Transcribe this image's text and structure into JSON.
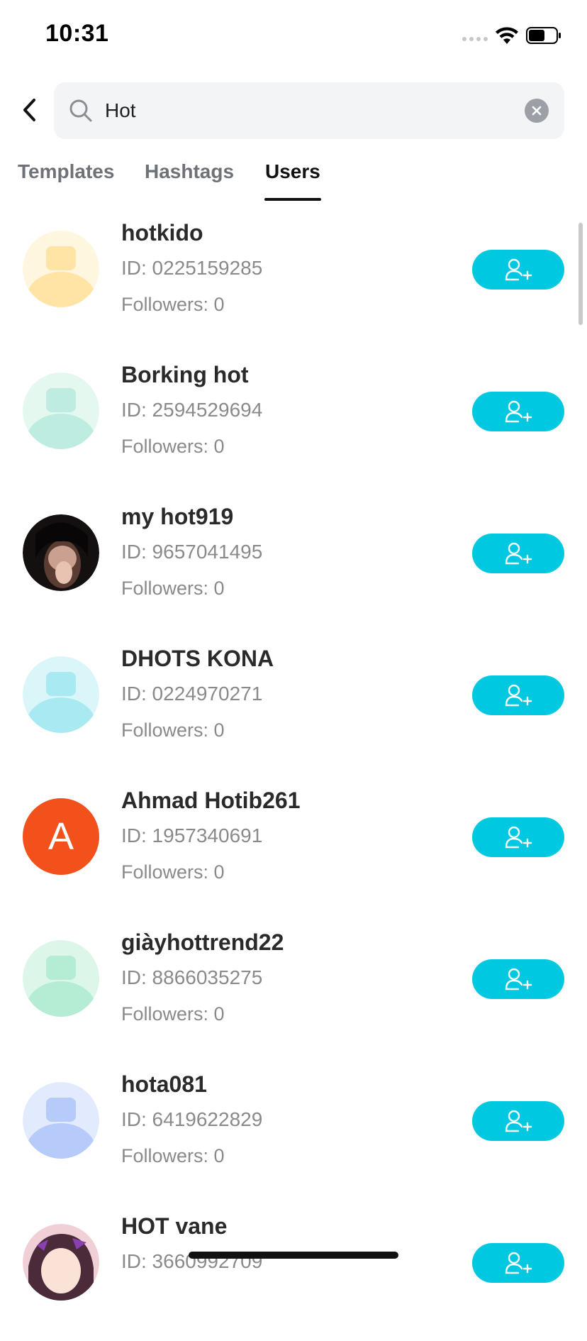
{
  "status_bar": {
    "time": "10:31"
  },
  "search": {
    "value": "Hot",
    "placeholder": ""
  },
  "tabs": [
    {
      "label": "Templates",
      "active": false
    },
    {
      "label": "Hashtags",
      "active": false
    },
    {
      "label": "Users",
      "active": true
    }
  ],
  "colors": {
    "accent": "#00c8e0",
    "orange_avatar": "#f2511b"
  },
  "users": [
    {
      "name": "hotkido",
      "id": "ID: 0225159285",
      "followers": "Followers: 0",
      "avatar": "default-avatar-yellow"
    },
    {
      "name": "Borking hot",
      "id": "ID: 2594529694",
      "followers": "Followers: 0",
      "avatar": "default-avatar-green"
    },
    {
      "name": "my hot919",
      "id": "ID: 9657041495",
      "followers": "Followers: 0",
      "avatar": "photo-avatar"
    },
    {
      "name": "DHOTS KONA",
      "id": "ID: 0224970271",
      "followers": "Followers: 0",
      "avatar": "default-avatar-cyan"
    },
    {
      "name": "Ahmad Hotib261",
      "id": "ID: 1957340691",
      "followers": "Followers: 0",
      "avatar": "letter-avatar",
      "initial": "A"
    },
    {
      "name": "giàyhottrend22",
      "id": "ID: 8866035275",
      "followers": "Followers: 0",
      "avatar": "default-avatar-mint"
    },
    {
      "name": "hota081",
      "id": "ID: 6419622829",
      "followers": "Followers: 0",
      "avatar": "default-avatar-blue"
    },
    {
      "name": "HOT vane",
      "id": "ID: 3660992709",
      "followers": "",
      "avatar": "anime-avatar"
    }
  ]
}
